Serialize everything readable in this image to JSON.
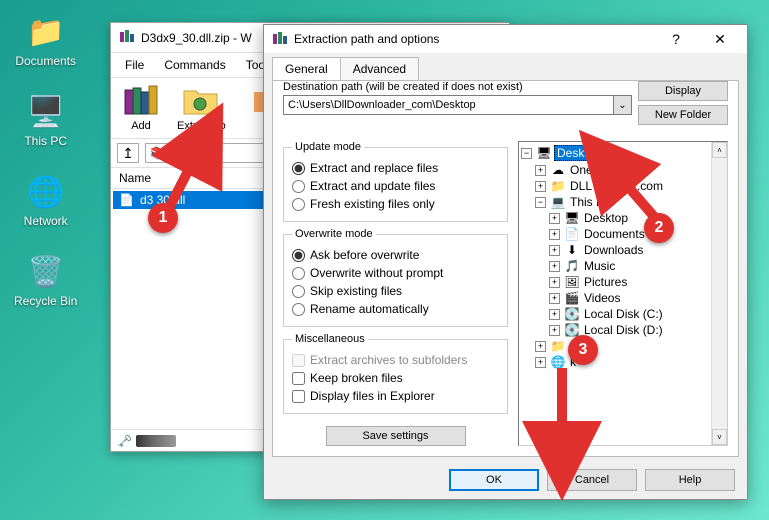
{
  "desktop": {
    "icons": [
      {
        "name": "documents-icon",
        "label": "Documents",
        "glyph": "📁"
      },
      {
        "name": "thispc-icon",
        "label": "This PC",
        "glyph": "🖥️"
      },
      {
        "name": "network-icon",
        "label": "Network",
        "glyph": "🌐"
      },
      {
        "name": "recyclebin-icon",
        "label": "Recycle Bin",
        "glyph": "🗑️"
      }
    ]
  },
  "winrar": {
    "title": "D3dx9_30.dll.zip - W",
    "menu": [
      "File",
      "Commands",
      "Tools"
    ],
    "tools": [
      {
        "name": "add-button",
        "label": "Add"
      },
      {
        "name": "extract-to-button",
        "label": "Extract To"
      }
    ],
    "archive_path_short": "dx9_30.",
    "list_header": "Name",
    "file": "d3         30.dll"
  },
  "dialog": {
    "title": "Extraction path and options",
    "tabs": {
      "general": "General",
      "advanced": "Advanced"
    },
    "dest_label": "Destination path (will be created if does not exist)",
    "dest_path": "C:\\Users\\DllDownloader_com\\Desktop",
    "display_btn": "Display",
    "newfolder_btn": "New Folder",
    "update_mode": {
      "legend": "Update mode",
      "opts": [
        "Extract and replace files",
        "Extract and update files",
        "Fresh existing files only"
      ]
    },
    "overwrite_mode": {
      "legend": "Overwrite mode",
      "opts": [
        "Ask before overwrite",
        "Overwrite without prompt",
        "Skip existing files",
        "Rename automatically"
      ]
    },
    "misc": {
      "legend": "Miscellaneous",
      "opts": [
        "Extract archives to subfolders",
        "Keep broken files",
        "Display files in Explorer"
      ]
    },
    "save_settings": "Save settings",
    "tree": {
      "desktop": "Desktop",
      "items": [
        {
          "expander": "+",
          "icon": "☁",
          "label": "OneD",
          "indent": 1
        },
        {
          "expander": "+",
          "icon": "📁",
          "label": "DLL Do       ader.com",
          "indent": 1
        },
        {
          "expander": "−",
          "icon": "💻",
          "label": "This PC",
          "indent": 1
        },
        {
          "expander": "+",
          "icon": "🖥",
          "label": "Desktop",
          "indent": 2
        },
        {
          "expander": "+",
          "icon": "📄",
          "label": "Documents",
          "indent": 2
        },
        {
          "expander": "+",
          "icon": "⬇",
          "label": "Downloads",
          "indent": 2
        },
        {
          "expander": "+",
          "icon": "🎵",
          "label": "Music",
          "indent": 2
        },
        {
          "expander": "+",
          "icon": "🖼",
          "label": "Pictures",
          "indent": 2
        },
        {
          "expander": "+",
          "icon": "🎬",
          "label": "Videos",
          "indent": 2
        },
        {
          "expander": "+",
          "icon": "💽",
          "label": "Local Disk (C:)",
          "indent": 2
        },
        {
          "expander": "+",
          "icon": "💽",
          "label": "Local Disk (D:)",
          "indent": 2
        },
        {
          "expander": "+",
          "icon": "📁",
          "label": "s",
          "indent": 1
        },
        {
          "expander": "+",
          "icon": "🌐",
          "label": "k",
          "indent": 1
        }
      ]
    },
    "footer": {
      "ok": "OK",
      "cancel": "Cancel",
      "help": "Help"
    }
  },
  "annotations": {
    "b1": "1",
    "b2": "2",
    "b3": "3"
  }
}
